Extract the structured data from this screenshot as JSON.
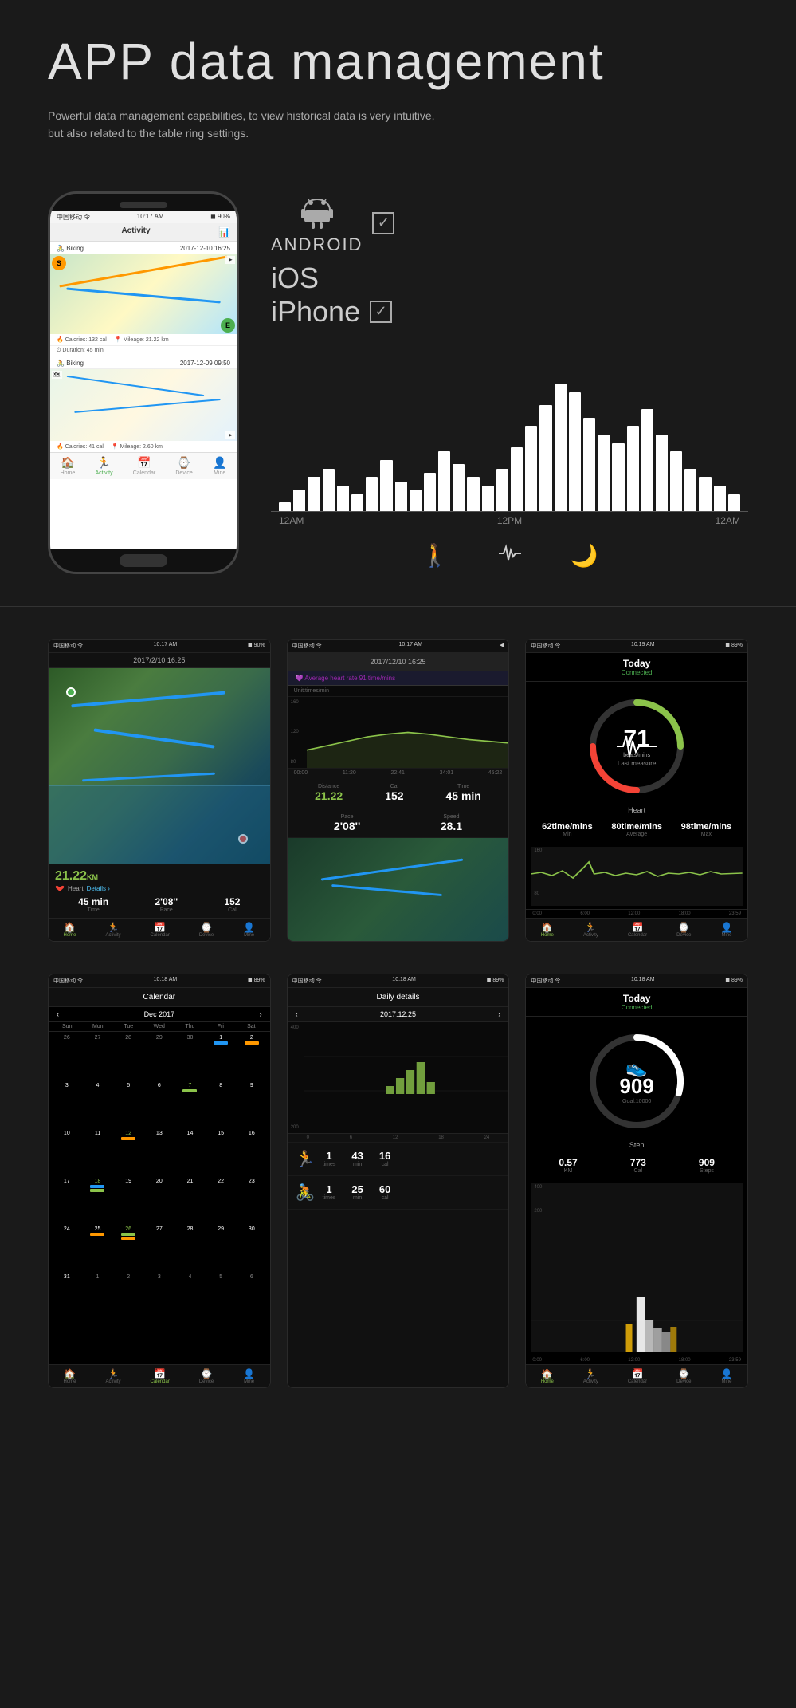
{
  "header": {
    "title": "APP data management",
    "subtitle_line1": "Powerful data management capabilities, to view historical data is very intuitive,",
    "subtitle_line2": "but also related to the table ring settings."
  },
  "platform": {
    "android_label": "ANDROID",
    "ios_label": "iOS",
    "iphone_label": "iPhone"
  },
  "chart": {
    "label_left": "12AM",
    "label_mid": "12PM",
    "label_right": "12AM",
    "bars": [
      2,
      5,
      8,
      10,
      6,
      4,
      8,
      12,
      7,
      5,
      9,
      14,
      11,
      8,
      6,
      10,
      15,
      20,
      25,
      30,
      28,
      22,
      18,
      16,
      20,
      24,
      18,
      14,
      10,
      8,
      6,
      4
    ],
    "icon_walk": "🚶",
    "icon_heart": "🫀",
    "icon_moon": "🌙"
  },
  "phone_activity": {
    "status_carrier": "中国移动 令",
    "status_time": "10:17 AM",
    "status_battery": "◼ 90%",
    "nav_title": "Activity",
    "activity1_label": "Biking",
    "activity1_date": "2017-12-10 16:25",
    "activity1_calories": "Calories: 132 cal",
    "activity1_mileage": "Mileage: 21.22 km",
    "activity1_duration": "Duration: 45 min",
    "activity2_label": "Biking",
    "activity2_date": "2017-12-09 09:50",
    "activity2_calories": "Calories: 41 cal",
    "activity2_mileage": "Mileage: 2.60 km",
    "nav_home": "Home",
    "nav_activity": "Activity",
    "nav_calendar": "Calendar",
    "nav_device": "Device",
    "nav_mine": "Mine"
  },
  "screenshots_row1": [
    {
      "id": "map_detail",
      "status_carrier": "中国移动 令",
      "status_time": "10:17 AM",
      "status_battery": "◼ 90%",
      "date": "2017/2/10 16:25",
      "distance_km": "21.22",
      "time_label": "Time",
      "pace_label": "Pace",
      "cal_label": "Cal",
      "time_val": "45 min",
      "pace_val": "2'08''",
      "cal_val": "152"
    },
    {
      "id": "activity_detail",
      "status_carrier": "中国移动 令",
      "status_time": "10:17 AM",
      "date_header": "2017/12/10 16:25",
      "avg_hr_label": "Average heart rate 91 time/mins",
      "unit_label": "Unit:times/min",
      "y_labels": [
        "160",
        "120",
        "80"
      ],
      "time_labels": [
        "00:00",
        "11:20",
        "22:41",
        "34:01",
        "45:22"
      ],
      "distance_label": "Distance",
      "cal_label": "Cal",
      "time_label": "Time",
      "distance_val": "21.22",
      "cal_val": "152",
      "time_val": "45 min",
      "pace_label": "Pace",
      "speed_label": "Speed",
      "pace_val": "2'08''",
      "speed_val": "28.1"
    },
    {
      "id": "heart_rate",
      "status_carrier": "中国移动 令",
      "status_time": "10:19 AM",
      "header_title": "Today",
      "connected": "Connected",
      "hr_value": "71",
      "hr_unit": "beats/mins",
      "hr_sub": "Last measure",
      "hr_section": "Heart",
      "min_val": "62time/mins",
      "avg_val": "80time/mins",
      "max_val": "98time/mins",
      "min_label": "Min",
      "avg_label": "Average",
      "max_label": "Max",
      "y_160": "160",
      "y_80": "80",
      "time_labels": [
        "0:00",
        "6:00",
        "12:00",
        "18:00",
        "23:59"
      ]
    }
  ],
  "screenshots_row2": [
    {
      "id": "calendar",
      "header_title": "Calendar",
      "month": "Dec 2017",
      "days_header": [
        "Sun",
        "Mon",
        "Tue",
        "Wed",
        "Thu",
        "Fri",
        "Sat"
      ],
      "weeks": [
        [
          "26",
          "27",
          "28",
          "29",
          "30",
          "1",
          "2"
        ],
        [
          "3",
          "4",
          "5",
          "6",
          "7",
          "8",
          "9"
        ],
        [
          "10",
          "11",
          "12",
          "13",
          "14",
          "15",
          "16"
        ],
        [
          "17",
          "18",
          "19",
          "20",
          "21",
          "22",
          "23"
        ],
        [
          "24",
          "25",
          "26",
          "27",
          "28",
          "29",
          "30"
        ],
        [
          "31",
          "1",
          "2",
          "3",
          "4",
          "5",
          "6"
        ]
      ],
      "active_days": [
        "7",
        "12",
        "18",
        "26"
      ],
      "nav_home": "Home",
      "nav_activity": "Activity",
      "nav_calendar": "Calendar",
      "nav_device": "Device",
      "nav_mine": "Mine"
    },
    {
      "id": "daily_details",
      "header_title": "Daily details",
      "date": "2017.12.25",
      "y_labels": [
        "400",
        "200"
      ],
      "x_labels": [
        "0",
        "6",
        "12",
        "18",
        "24"
      ],
      "run_times": "1",
      "run_min": "43",
      "run_cal": "16",
      "run_unit_times": "times",
      "run_unit_min": "min",
      "run_unit_cal": "cal",
      "bike_times": "1",
      "bike_min": "25",
      "bike_cal": "60",
      "bike_unit_times": "times",
      "bike_unit_min": "min",
      "bike_unit_cal": "cal"
    },
    {
      "id": "step_count",
      "header_title": "Today",
      "connected": "Connected",
      "step_value": "909",
      "step_goal": "Goal:10000",
      "step_label": "Step",
      "km_val": "0.57",
      "cal_val": "773",
      "steps_val": "909",
      "km_label": "KM",
      "cal_label": "Cal",
      "steps_label": "Steps",
      "y_labels": [
        "400",
        "200"
      ],
      "time_labels": [
        "0:00",
        "6:00",
        "12:00",
        "18:00",
        "23:59"
      ],
      "nav_home": "Home",
      "nav_activity": "Activity",
      "nav_calendar": "Calendar",
      "nav_device": "Device",
      "nav_mine": "Mine"
    }
  ]
}
